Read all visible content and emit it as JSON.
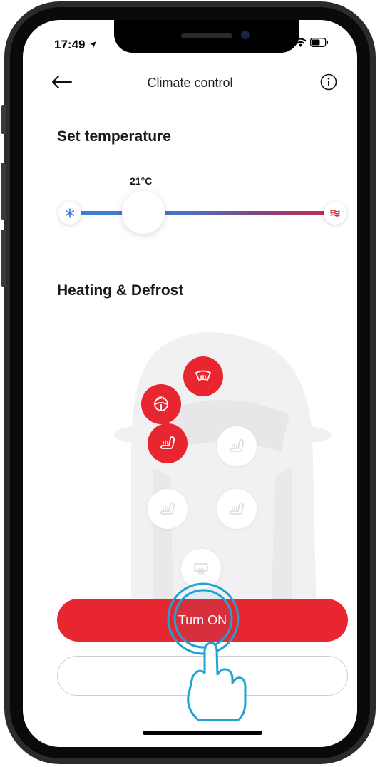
{
  "status_bar": {
    "time": "17:49"
  },
  "header": {
    "title": "Climate control"
  },
  "temperature": {
    "section_title": "Set temperature",
    "value": "21°C",
    "level": 0.2
  },
  "heating": {
    "section_title": "Heating & Defrost",
    "controls": [
      {
        "name": "front-windshield-defrost",
        "state": "on"
      },
      {
        "name": "steering-wheel-heat",
        "state": "on"
      },
      {
        "name": "driver-seat-heat",
        "state": "on"
      },
      {
        "name": "passenger-seat-heat",
        "state": "off"
      },
      {
        "name": "rear-left-seat-heat",
        "state": "off"
      },
      {
        "name": "rear-right-seat-heat",
        "state": "off"
      },
      {
        "name": "rear-window-defrost",
        "state": "off"
      }
    ]
  },
  "actions": {
    "primary_label": "Turn ON",
    "secondary_label": "Sc"
  },
  "colors": {
    "accent": "#e8262f",
    "cold": "#3d7fd3",
    "hot": "#d02b3a",
    "gesture": "#1ea3d4"
  }
}
